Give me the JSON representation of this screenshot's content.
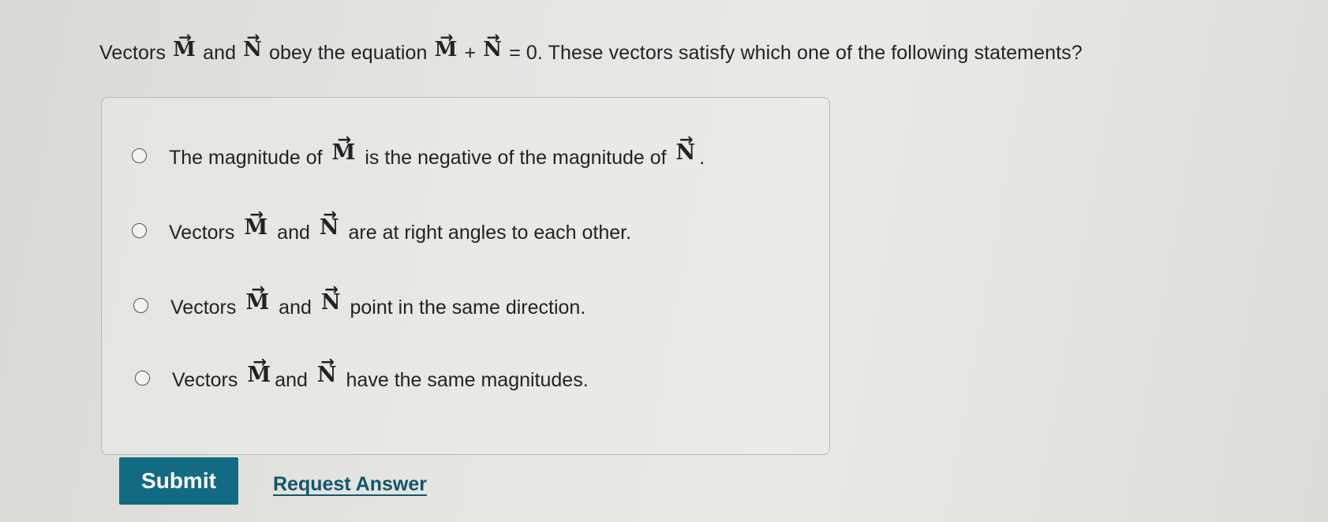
{
  "question": {
    "prefix": "Vectors",
    "vector_m": "M",
    "conj": "and",
    "vector_n": "N",
    "mid": "obey the equation",
    "plus": "+",
    "suffix": "= 0. These vectors satisfy which one of the following statements?"
  },
  "options": [
    {
      "before": "The magnitude of",
      "v1": "M",
      "middle": "is the negative of the magnitude of",
      "v2": "N",
      "after": ".",
      "selected": false
    },
    {
      "before": "Vectors",
      "v1": "M",
      "middle": "and",
      "v2": "N",
      "after": "are at right angles to each other.",
      "selected": false
    },
    {
      "before": "Vectors",
      "v1": "M",
      "middle": "and",
      "v2": "N",
      "after": "point in the same direction.",
      "selected": false
    },
    {
      "before": "Vectors",
      "v1": "M",
      "middle": "and",
      "v2": "N",
      "after": "have the same magnitudes.",
      "selected": false
    }
  ],
  "actions": {
    "submit_label": "Submit",
    "request_answer_label": "Request Answer"
  },
  "icons": {
    "vector_arrow": "→",
    "radio": "radio-empty-icon"
  },
  "colors": {
    "submit_bg": "#136b83",
    "link": "#11566d"
  }
}
